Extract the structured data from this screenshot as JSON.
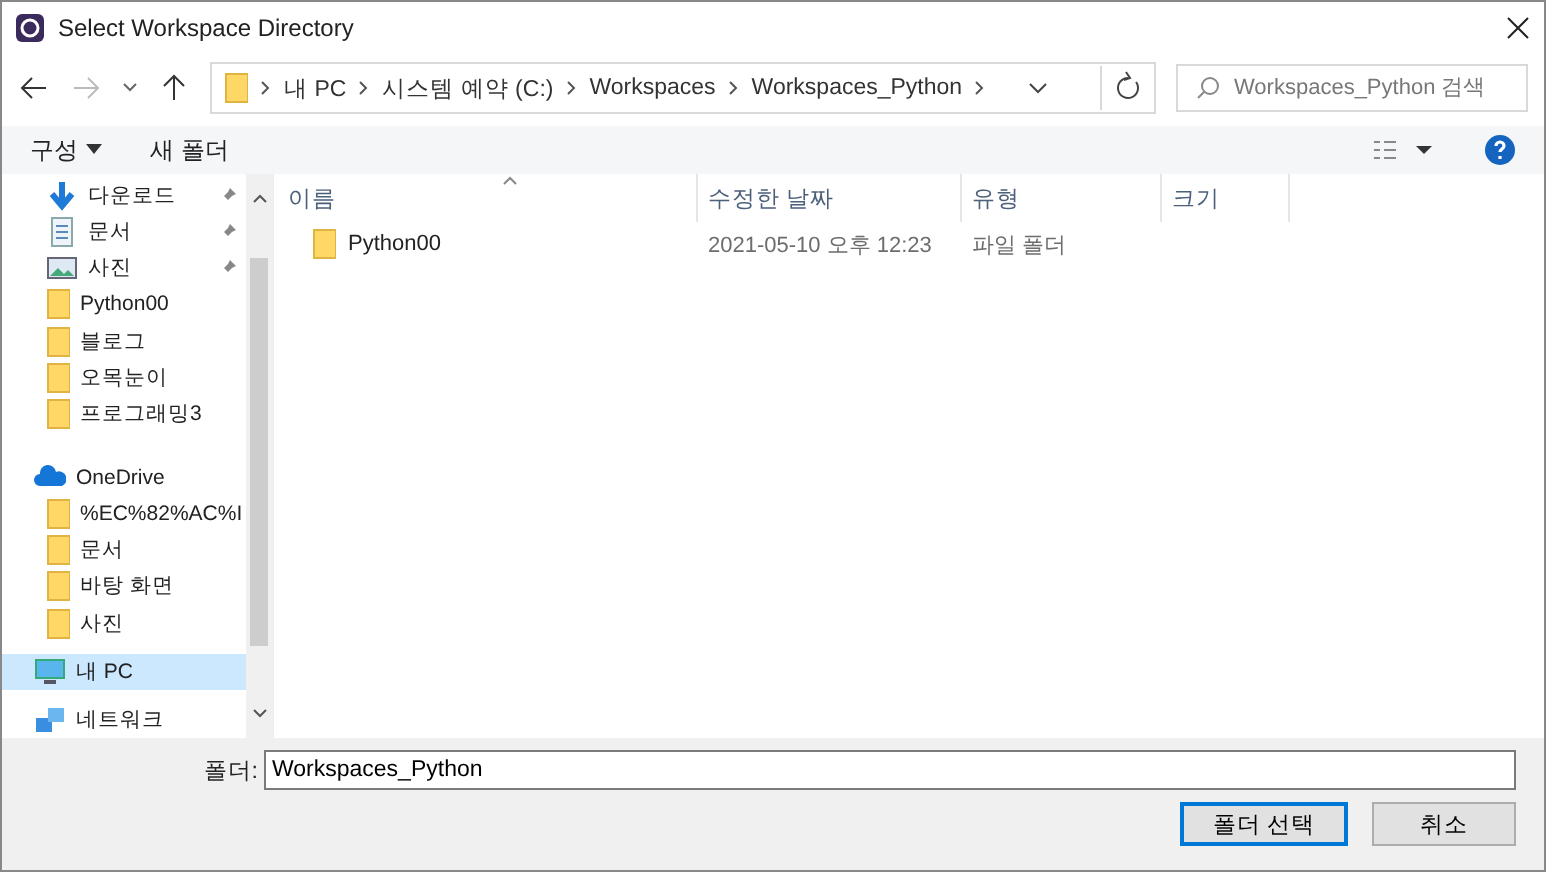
{
  "window": {
    "title": "Select Workspace Directory"
  },
  "breadcrumb": [
    "내 PC",
    "시스템 예약 (C:)",
    "Workspaces",
    "Workspaces_Python"
  ],
  "search": {
    "placeholder": "Workspaces_Python 검색"
  },
  "toolbar": {
    "organize": "구성",
    "new_folder": "새 폴더"
  },
  "sidebar": {
    "items": [
      {
        "label": "다운로드",
        "kind": "download",
        "pinned": true,
        "selected": false
      },
      {
        "label": "문서",
        "kind": "document",
        "pinned": true,
        "selected": false
      },
      {
        "label": "사진",
        "kind": "picture",
        "pinned": true,
        "selected": false
      },
      {
        "label": "Python00",
        "kind": "folder",
        "pinned": false,
        "selected": false
      },
      {
        "label": "블로그",
        "kind": "folder",
        "pinned": false,
        "selected": false
      },
      {
        "label": "오목눈이",
        "kind": "folder",
        "pinned": false,
        "selected": false
      },
      {
        "label": "프로그래밍3",
        "kind": "folder",
        "pinned": false,
        "selected": false
      },
      {
        "label": "OneDrive",
        "kind": "cloud",
        "pinned": false,
        "selected": false
      },
      {
        "label": "%EC%82%AC%I",
        "kind": "folder",
        "pinned": false,
        "selected": false
      },
      {
        "label": "문서",
        "kind": "folder",
        "pinned": false,
        "selected": false
      },
      {
        "label": "바탕 화면",
        "kind": "folder",
        "pinned": false,
        "selected": false
      },
      {
        "label": "사진",
        "kind": "folder",
        "pinned": false,
        "selected": false
      },
      {
        "label": "내 PC",
        "kind": "pc",
        "pinned": false,
        "selected": true
      },
      {
        "label": "네트워크",
        "kind": "network",
        "pinned": false,
        "selected": false
      }
    ]
  },
  "table": {
    "columns": [
      "이름",
      "수정한 날짜",
      "유형",
      "크기"
    ],
    "rows": [
      {
        "name": "Python00",
        "modified": "2021-05-10 오후 12:23",
        "type": "파일 폴더",
        "selected": false
      }
    ]
  },
  "folder_field": {
    "label": "폴더:",
    "value": "Workspaces_Python"
  },
  "buttons": [
    "폴더 선택",
    "취소"
  ]
}
